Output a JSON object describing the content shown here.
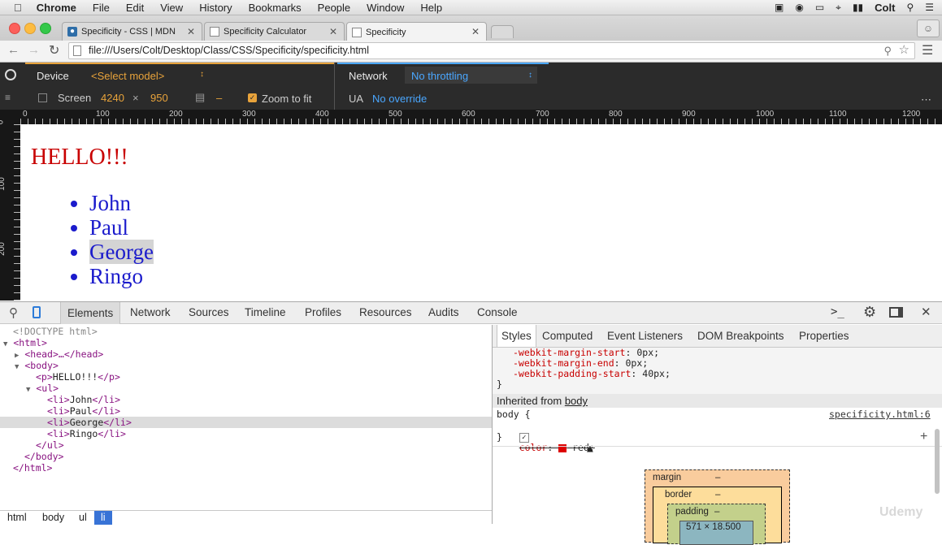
{
  "menubar": {
    "app": "Chrome",
    "items": [
      "File",
      "Edit",
      "View",
      "History",
      "Bookmarks",
      "People",
      "Window",
      "Help"
    ],
    "user": "Colt"
  },
  "tabs": [
    {
      "title": "Specificity - CSS | MDN"
    },
    {
      "title": "Specificity Calculator"
    },
    {
      "title": "Specificity"
    }
  ],
  "address": {
    "url": "file:///Users/Colt/Desktop/Class/CSS/Specificity/specificity.html"
  },
  "device": {
    "device_label": "Device",
    "model": "<Select model>",
    "screen_label": "Screen",
    "width": "4240",
    "times": "×",
    "height": "950",
    "dash": "–",
    "zoom_label": "Zoom to fit",
    "network_label": "Network",
    "network_value": "No throttling",
    "ua_label": "UA",
    "ua_value": "No override"
  },
  "ruler": {
    "h_ticks": [
      "0",
      "100",
      "200",
      "300",
      "400",
      "500",
      "600",
      "700",
      "800",
      "900",
      "1000",
      "1100",
      "1200"
    ],
    "v_ticks": [
      "0",
      "100",
      "200"
    ]
  },
  "page": {
    "heading": "HELLO!!!",
    "items": [
      "John",
      "Paul",
      "George",
      "Ringo"
    ]
  },
  "devtools": {
    "tabs": [
      "Elements",
      "Network",
      "Sources",
      "Timeline",
      "Profiles",
      "Resources",
      "Audits",
      "Console"
    ],
    "tree": {
      "doctype": "<!DOCTYPE html>",
      "html_open": "<html>",
      "head": "<head>…</head>",
      "body_open": "<body>",
      "p_open": "<p>",
      "p_text": "HELLO!!!",
      "p_close": "</p>",
      "ul_open": "<ul>",
      "li_open": "<li>",
      "li_close": "</li>",
      "ul_close": "</ul>",
      "body_close": "</body>",
      "html_close": "</html>"
    },
    "breadcrumbs": [
      "html",
      "body",
      "ul",
      "li"
    ],
    "styles_tabs": [
      "Styles",
      "Computed",
      "Event Listeners",
      "DOM Breakpoints",
      "Properties"
    ],
    "ua_rules": [
      {
        "prop": "-webkit-margin-start",
        "value": "0px;"
      },
      {
        "prop": "-webkit-margin-end",
        "value": "0px;"
      },
      {
        "prop": "-webkit-padding-start",
        "value": "40px;"
      }
    ],
    "brace_close": "}",
    "inherited_label": "Inherited from",
    "inherited_from": "body",
    "body_rule": {
      "selector": "body {",
      "source": "specificity.html:6",
      "prop": "color",
      "value": "red;",
      "swatch_color": "#dd0000"
    },
    "plus": "+",
    "box_model": {
      "margin": "margin",
      "margin_val": "–",
      "border": "border",
      "border_val": "–",
      "padding": "padding",
      "padding_val": "–",
      "content": "571 × 18.500"
    }
  },
  "watermark": "Udemy"
}
